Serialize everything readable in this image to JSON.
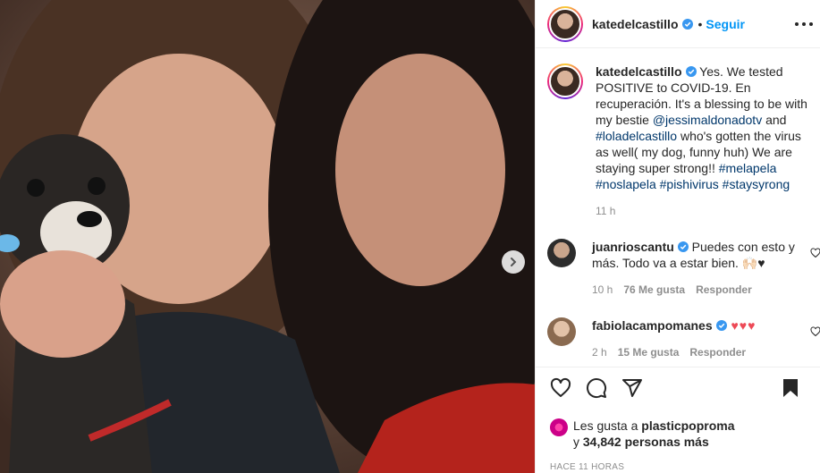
{
  "header": {
    "username": "katedelcastillo",
    "separator": "•",
    "follow_label": "Seguir"
  },
  "caption": {
    "username": "katedelcastillo",
    "text_1": " Yes. We tested POSITIVE to COVID-19. En recuperación. It's a blessing to be with my bestie ",
    "mention_1": "@jessimaldonadotv",
    "text_2": " and ",
    "mention_2": "#loladelcastillo",
    "text_3": " who's gotten the virus as well( my dog, funny huh) We are staying super strong!! ",
    "hashtag_1": "#melapela",
    "hashtag_2": "#noslapela",
    "hashtag_3": "#pishivirus",
    "hashtag_4": "#staysyrong",
    "time": "11 h"
  },
  "comments": [
    {
      "username": "juanrioscantu",
      "text": " Puedes con esto y más. Todo va a estar bien. 🙌🏻♥",
      "time": "10 h",
      "likes": "76 Me gusta",
      "reply": "Responder"
    },
    {
      "username": "fabiolacampomanes",
      "text": " ♥♥♥",
      "time": "2 h",
      "likes": "15 Me gusta",
      "reply": "Responder"
    }
  ],
  "likes": {
    "prefix": "Les gusta a ",
    "username": "plasticpoproma",
    "middle": " y ",
    "count": "34,842 personas más"
  },
  "timestamp": "Hace 11 horas",
  "colors": {
    "link_blue": "#0095f6",
    "tag_blue": "#00376b",
    "verified_blue": "#3897f0",
    "heart_red": "#ed4956",
    "muted": "#8e8e8e"
  }
}
